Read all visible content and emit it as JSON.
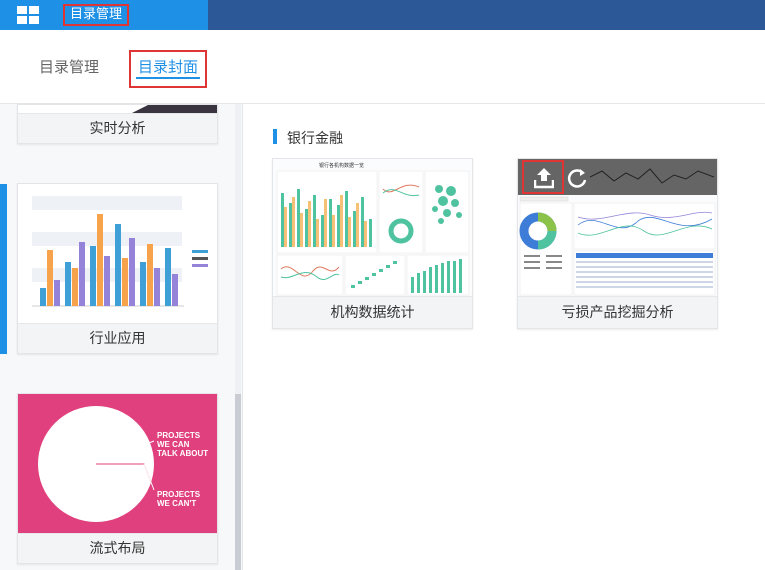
{
  "topbar": {
    "title": "目录管理",
    "menu_icon": "grid-icon",
    "colors": {
      "bar": "#2c5898",
      "accent": "#1e90e6",
      "highlight": "#e03535"
    }
  },
  "tabs": [
    {
      "label": "目录管理",
      "active": false
    },
    {
      "label": "目录封面",
      "active": true
    }
  ],
  "sidebar": {
    "items": [
      {
        "label": "实时分析"
      },
      {
        "label": "行业应用",
        "active": true
      },
      {
        "label": "流式布局",
        "pie_labels": [
          "PROJECTS",
          "WE CAN",
          "TALK ABOUT",
          "PROJECTS",
          "WE CAN'T"
        ]
      }
    ]
  },
  "section": {
    "title": "银行金融"
  },
  "cards": [
    {
      "label": "机构数据统计",
      "thumb_title": "银行各机构数据一览"
    },
    {
      "label": "亏损产品挖掘分析",
      "overlay_icons": [
        "upload-icon",
        "refresh-icon"
      ]
    }
  ]
}
